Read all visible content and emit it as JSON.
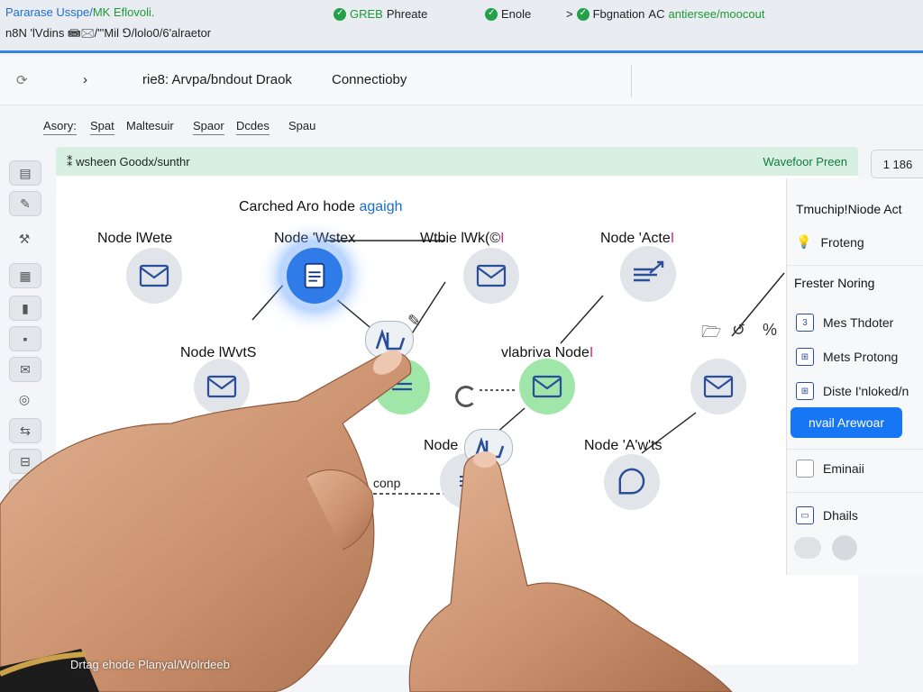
{
  "browser": {
    "tab_title": "Pararase Usspe/",
    "tab_title_alt": "MK Eflovoli.",
    "address": "n8N 'lVdins 📾🖂/\"'Mil ⅁/lolo0/6'alraetor",
    "chips": [
      {
        "status": "GREB",
        "text": "Phreate"
      },
      {
        "status": "✓",
        "text": "Enole"
      },
      {
        "status": "Fbgnation",
        "text": "AC",
        "extra": "antiersee/moocout"
      }
    ]
  },
  "header": {
    "back_icon": "refresh-icon",
    "forward_icon": "chevron-right-icon",
    "breadcrumb": "rie8: Arvpa/bndout Draok",
    "title": "Connectioby"
  },
  "tabs": [
    "Asory:",
    "Spat",
    "Maltesuir",
    "Spaor",
    "Dcdes",
    "Spau"
  ],
  "toolbar": {
    "tools": [
      "file-icon",
      "pin-icon",
      "tools-icon",
      "page-icon",
      "bracket-icon",
      "view-icon",
      "mail-icon",
      "globe-icon",
      "arrows-icon",
      "split-icon",
      "list-icon"
    ]
  },
  "canvas": {
    "banner_left": "⁑ wsheen Goodx/sunthr",
    "banner_right": "Wavefoor Preen",
    "caption": "Carched Aro hode",
    "caption_accent": "agaigh",
    "connector_label": "conp",
    "nodes": [
      {
        "label": "Node",
        "suffix": "lWete",
        "icon": "mail-icon"
      },
      {
        "label": "Node",
        "suffix": "'Wstex",
        "icon": "document-icon",
        "selected": true
      },
      {
        "label": "Wtbie",
        "suffix": "lWk(©",
        "icon": "mail-icon"
      },
      {
        "label": "Node",
        "suffix": "'Acte",
        "icon": "lines-arrow-icon"
      },
      {
        "label": "Node",
        "suffix": "lWvtS",
        "icon": "mail-icon"
      },
      {
        "label": "vlabriva",
        "suffix": "Node",
        "icon": "mail-icon",
        "green": true
      },
      {
        "label": "Node",
        "suffix": "'A'w'ts",
        "icon": "mail-icon"
      },
      {
        "label": "Node",
        "suffix": "",
        "icon": "doc-lines-icon"
      },
      {
        "label": "",
        "suffix": "",
        "icon": "chat-icon"
      }
    ]
  },
  "right_panel": {
    "count_badge": "1 186",
    "title": "Tmuchip!Niode Act",
    "top_item": "Froteng",
    "section": "Frester Noring",
    "items": [
      "Mes Thdoter",
      "Mets Protong",
      "Diste I'nloked/n"
    ],
    "button": "nvail Arewoar",
    "lower_items": [
      "Eminaii",
      "Dhails"
    ]
  },
  "footer": {
    "caption": "Drtag ehode Planyal/Wolrdeeb"
  }
}
